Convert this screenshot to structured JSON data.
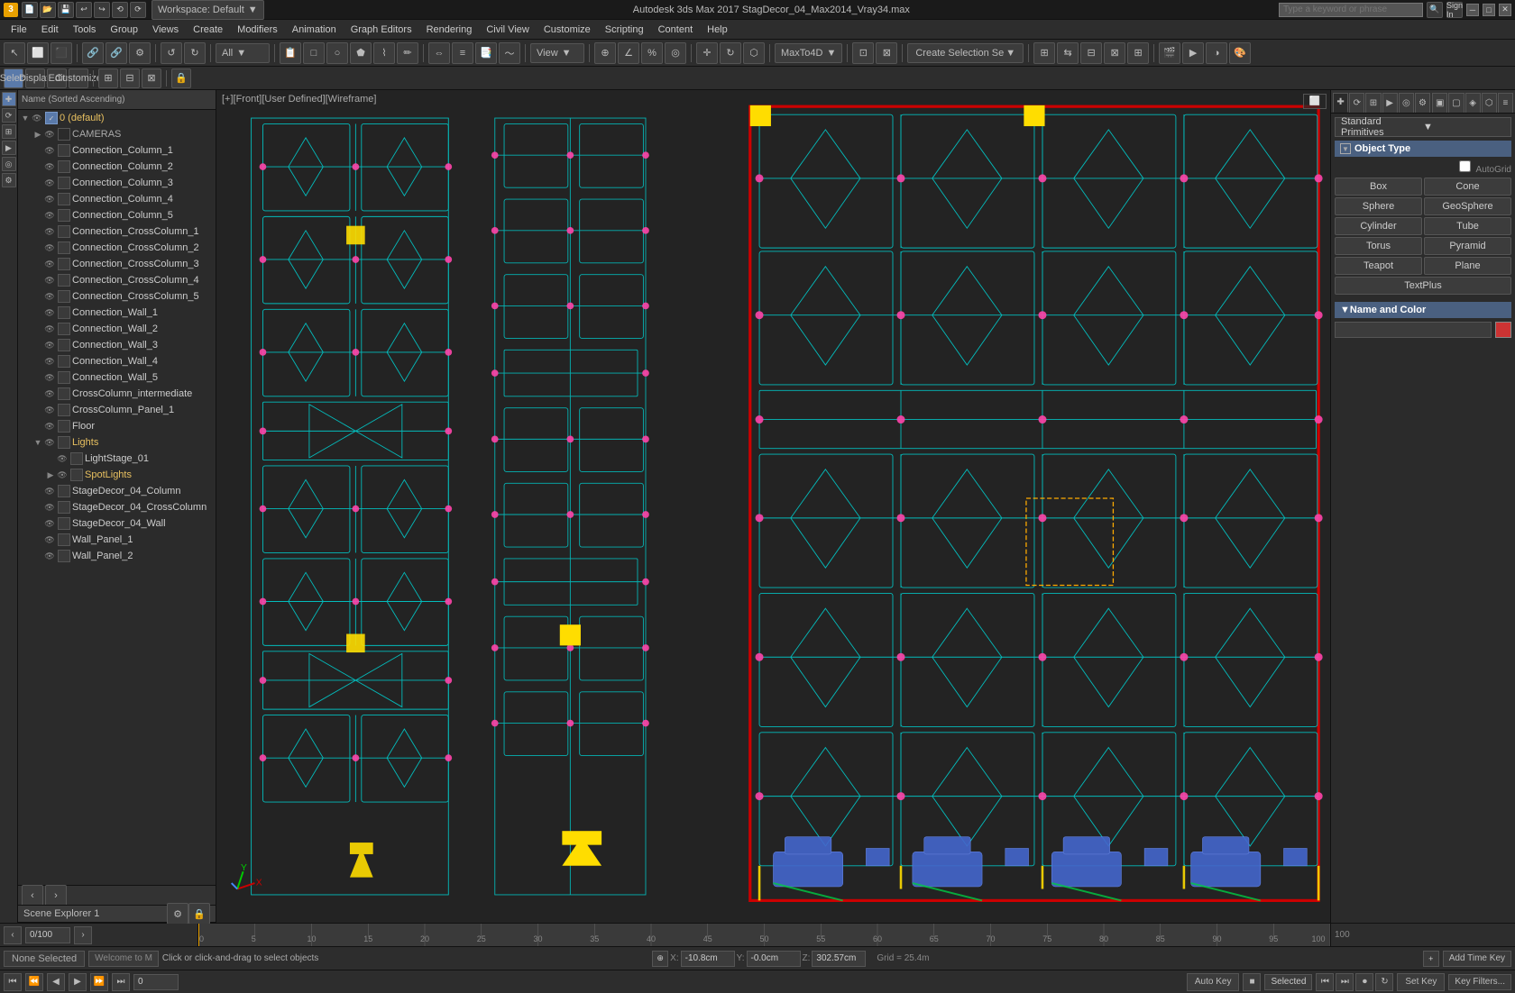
{
  "app": {
    "icon_label": "3",
    "title": "Autodesk 3ds Max 2017  StagDecor_04_Max2014_Vray34.max",
    "search_placeholder": "Type a keyword or phrase",
    "workspace_label": "Workspace: Default",
    "sign_in_label": "Sign In"
  },
  "menu": {
    "items": [
      {
        "label": "File",
        "id": "file"
      },
      {
        "label": "Edit",
        "id": "edit"
      },
      {
        "label": "Tools",
        "id": "tools"
      },
      {
        "label": "Group",
        "id": "group"
      },
      {
        "label": "Views",
        "id": "views"
      },
      {
        "label": "Create",
        "id": "create"
      },
      {
        "label": "Modifiers",
        "id": "modifiers"
      },
      {
        "label": "Animation",
        "id": "animation"
      },
      {
        "label": "Graph Editors",
        "id": "graph-editors"
      },
      {
        "label": "Rendering",
        "id": "rendering"
      },
      {
        "label": "Civil View",
        "id": "civil-view"
      },
      {
        "label": "Customize",
        "id": "customize"
      },
      {
        "label": "Scripting",
        "id": "scripting"
      },
      {
        "label": "Content",
        "id": "content"
      },
      {
        "label": "Help",
        "id": "help"
      }
    ]
  },
  "sub_toolbar": {
    "select_label": "Select",
    "display_label": "Display",
    "edit_label": "Edit",
    "customize_label": "Customize"
  },
  "toolbar": {
    "filter_label": "All",
    "view_label": "View",
    "maxtrac_label": "MaxTo4D",
    "create_selection_label": "Create Selection Se"
  },
  "scene_explorer": {
    "tab_label": "Scene Explorer 1",
    "sort_label": "Name (Sorted Ascending)",
    "tree_items": [
      {
        "id": "default",
        "label": "0 (default)",
        "level": 0,
        "type": "group",
        "expandable": true,
        "expanded": true
      },
      {
        "id": "cameras",
        "label": "CAMERAS",
        "level": 1,
        "type": "group",
        "expandable": true,
        "expanded": false
      },
      {
        "id": "connection_column_1",
        "label": "Connection_Column_1",
        "level": 1,
        "type": "object",
        "expandable": false
      },
      {
        "id": "connection_column_2",
        "label": "Connection_Column_2",
        "level": 1,
        "type": "object",
        "expandable": false
      },
      {
        "id": "connection_column_3",
        "label": "Connection_Column_3",
        "level": 1,
        "type": "object",
        "expandable": false
      },
      {
        "id": "connection_column_4",
        "label": "Connection_Column_4",
        "level": 1,
        "type": "object",
        "expandable": false
      },
      {
        "id": "connection_column_5",
        "label": "Connection_Column_5",
        "level": 1,
        "type": "object",
        "expandable": false
      },
      {
        "id": "connection_crosscolumn_1",
        "label": "Connection_CrossColumn_1",
        "level": 1,
        "type": "object",
        "expandable": false
      },
      {
        "id": "connection_crosscolumn_2",
        "label": "Connection_CrossColumn_2",
        "level": 1,
        "type": "object",
        "expandable": false
      },
      {
        "id": "connection_crosscolumn_3",
        "label": "Connection_CrossColumn_3",
        "level": 1,
        "type": "object",
        "expandable": false
      },
      {
        "id": "connection_crosscolumn_4",
        "label": "Connection_CrossColumn_4",
        "level": 1,
        "type": "object",
        "expandable": false
      },
      {
        "id": "connection_crosscolumn_5",
        "label": "Connection_CrossColumn_5",
        "level": 1,
        "type": "object",
        "expandable": false
      },
      {
        "id": "connection_wall_1",
        "label": "Connection_Wall_1",
        "level": 1,
        "type": "object",
        "expandable": false
      },
      {
        "id": "connection_wall_2",
        "label": "Connection_Wall_2",
        "level": 1,
        "type": "object",
        "expandable": false
      },
      {
        "id": "connection_wall_3",
        "label": "Connection_Wall_3",
        "level": 1,
        "type": "object",
        "expandable": false
      },
      {
        "id": "connection_wall_4",
        "label": "Connection_Wall_4",
        "level": 1,
        "type": "object",
        "expandable": false
      },
      {
        "id": "connection_wall_5",
        "label": "Connection_Wall_5",
        "level": 1,
        "type": "object",
        "expandable": false
      },
      {
        "id": "crosscolumn_intermediate",
        "label": "CrossColumn_intermediate",
        "level": 1,
        "type": "object",
        "expandable": false
      },
      {
        "id": "crosscolumn_panel_1",
        "label": "CrossColumn_Panel_1",
        "level": 1,
        "type": "object",
        "expandable": false
      },
      {
        "id": "floor",
        "label": "Floor",
        "level": 1,
        "type": "object",
        "expandable": false
      },
      {
        "id": "lights",
        "label": "Lights",
        "level": 1,
        "type": "group",
        "expandable": true,
        "expanded": false
      },
      {
        "id": "lightstage_01",
        "label": "LightStage_01",
        "level": 2,
        "type": "object",
        "expandable": false
      },
      {
        "id": "spotlights",
        "label": "SpotLights",
        "level": 2,
        "type": "group",
        "expandable": false
      },
      {
        "id": "stagedecor_04_column",
        "label": "StageDecor_04_Column",
        "level": 1,
        "type": "object",
        "expandable": false
      },
      {
        "id": "stagedecor_04_crosscolumn",
        "label": "StageDecor_04_CrossColumn",
        "level": 1,
        "type": "object",
        "expandable": false
      },
      {
        "id": "stagedecor_04_wall",
        "label": "StageDecor_04_Wall",
        "level": 1,
        "type": "object",
        "expandable": false
      },
      {
        "id": "wall_panel_1",
        "label": "Wall_Panel_1",
        "level": 1,
        "type": "object",
        "expandable": false
      },
      {
        "id": "wall_panel_2",
        "label": "Wall_Panel_2",
        "level": 1,
        "type": "object",
        "expandable": false
      }
    ]
  },
  "viewport": {
    "label": "[+][Front][User Defined][Wireframe]",
    "grid_size": "Grid = 25.4m"
  },
  "right_panel": {
    "primitives_label": "Standard Primitives",
    "object_type_label": "Object Type",
    "autogrid_label": "AutoGrid",
    "buttons": [
      {
        "label": "Box",
        "id": "box"
      },
      {
        "label": "Cone",
        "id": "cone"
      },
      {
        "label": "Sphere",
        "id": "sphere"
      },
      {
        "label": "GeoSphere",
        "id": "geosphere"
      },
      {
        "label": "Cylinder",
        "id": "cylinder"
      },
      {
        "label": "Tube",
        "id": "tube"
      },
      {
        "label": "Torus",
        "id": "torus"
      },
      {
        "label": "Pyramid",
        "id": "pyramid"
      },
      {
        "label": "Teapot",
        "id": "teapot"
      },
      {
        "label": "Plane",
        "id": "plane"
      },
      {
        "label": "TextPlus",
        "id": "textplus"
      }
    ],
    "name_color_label": "Name and Color",
    "color_value": "#cc3333"
  },
  "status_bar": {
    "none_selected_label": "None Selected",
    "welcome_label": "Welcome to M",
    "click_label": "Click or click-and-drag to select objects",
    "x_label": "X:",
    "x_value": "-10.8cm",
    "y_label": "Y:",
    "y_value": "-0.0cm",
    "z_label": "Z:",
    "z_value": "302.57cm",
    "grid_label": "Grid = 25.4m",
    "add_time_key_label": "Add Time Key"
  },
  "anim_bar": {
    "auto_key_label": "Auto Key",
    "selected_label": "Selected",
    "set_key_label": "Set Key",
    "key_filters_label": "Key Filters..."
  },
  "timeline": {
    "frame_start": "0",
    "frame_end": "100",
    "current_frame": "0",
    "markers": [
      0,
      5,
      10,
      15,
      20,
      25,
      30,
      35,
      40,
      45,
      50,
      55,
      60,
      65,
      70,
      75,
      80,
      85,
      90,
      95,
      100
    ]
  }
}
